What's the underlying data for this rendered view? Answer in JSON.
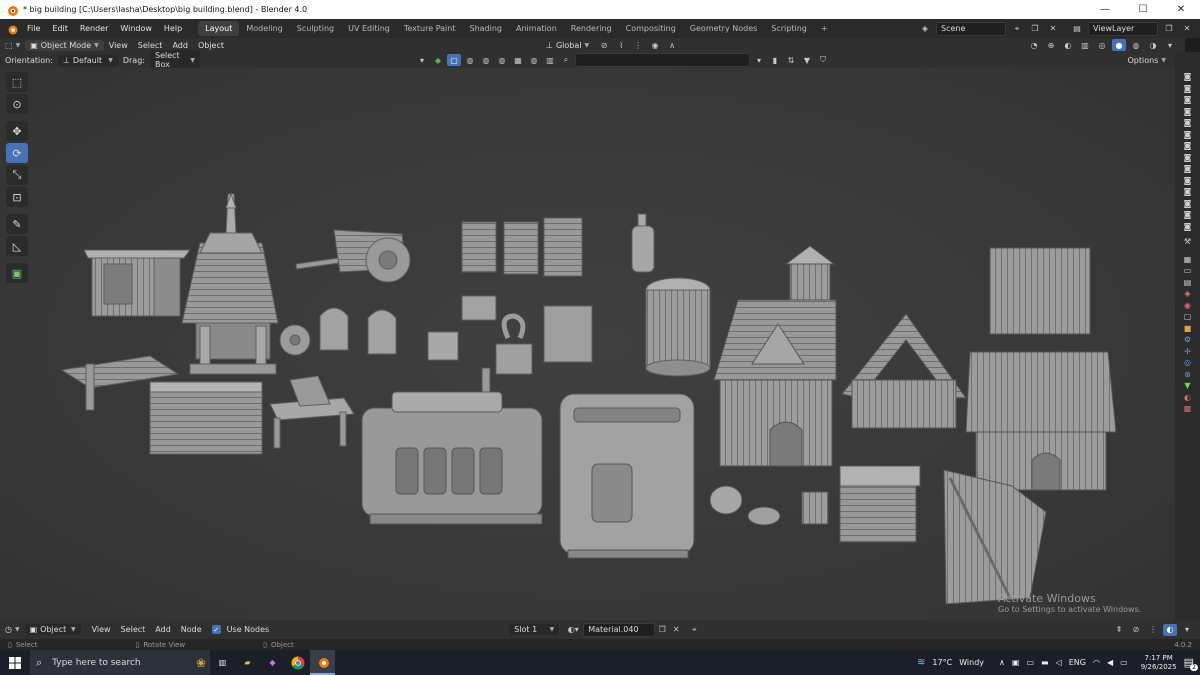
{
  "window": {
    "title": "* big building [C:\\Users\\lasha\\Desktop\\big building.blend] - Blender 4.0",
    "minimize": "—",
    "maximize": "☐",
    "close": "✕"
  },
  "menubar": {
    "menus": [
      "File",
      "Edit",
      "Render",
      "Window",
      "Help"
    ],
    "workspaces": [
      "Layout",
      "Modeling",
      "Sculpting",
      "UV Editing",
      "Texture Paint",
      "Shading",
      "Animation",
      "Rendering",
      "Compositing",
      "Geometry Nodes",
      "Scripting"
    ],
    "active_workspace": "Layout",
    "add_workspace": "+",
    "scene": "Scene",
    "view_layer": "ViewLayer"
  },
  "viewport_header": {
    "mode": "Object Mode",
    "menus": [
      "View",
      "Select",
      "Add",
      "Object"
    ],
    "transform_orientation": "Global"
  },
  "tool_header": {
    "orientation_label": "Orientation:",
    "orientation_value": "Default",
    "drag_label": "Drag:",
    "drag_value": "Select Box",
    "options": "Options"
  },
  "watermark": {
    "line1": "Activate Windows",
    "line2": "Go to Settings to activate Windows."
  },
  "node_header": {
    "editor_mode": "Object",
    "menus": [
      "View",
      "Select",
      "Add",
      "Node"
    ],
    "use_nodes_label": "Use Nodes",
    "use_nodes_checked": true,
    "slot": "Slot 1",
    "material": "Material.040"
  },
  "statusbar": {
    "left_hint": "Select",
    "mid_hint": "Rotate View",
    "right_hint": "Object",
    "version": "4.0.2"
  },
  "taskbar": {
    "search_placeholder": "Type here to search",
    "weather_temp": "17°C",
    "weather_desc": "Windy",
    "language": "ENG",
    "time": "7:17 PM",
    "date": "9/26/2025",
    "notifications": "2"
  },
  "colors": {
    "accent": "#4772b3",
    "viewport_bg": "#3a3a3a",
    "model_gray": "#9a9a9a"
  }
}
